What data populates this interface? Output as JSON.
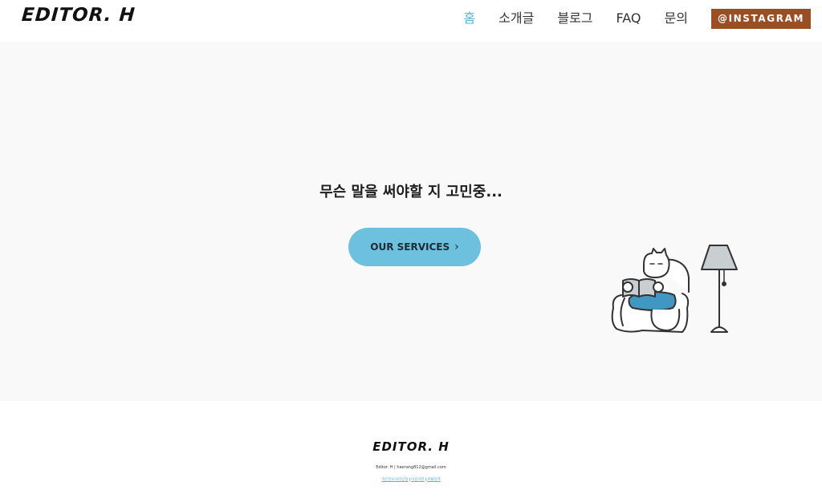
{
  "header": {
    "logo": "EDITOR. H",
    "nav": [
      "홈",
      "소개글",
      "블로그",
      "FAQ",
      "문의"
    ],
    "instagram_label": "@INSTAGRAM"
  },
  "hero": {
    "headline": "무슨 말을 써야할 지 고민중...",
    "cta_label": "OUR SERVICES",
    "cta_icon": "chevron-right-icon"
  },
  "footer": {
    "logo": "EDITOR. H",
    "line": "Editor. H  |  haerang812@gmail.com",
    "links": [
      "개인정보처리방침",
      "이용약관",
      "환불정책"
    ]
  },
  "colors": {
    "accent": "#5ab3d3",
    "cta_bg": "#6ec1de",
    "instagram_bg": "#9a4e24",
    "hero_bg": "#f9f9f9"
  }
}
